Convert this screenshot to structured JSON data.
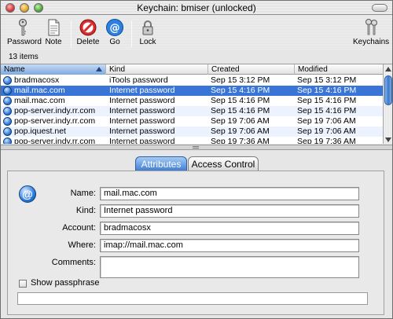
{
  "window": {
    "title": "Keychain: bmiser (unlocked)"
  },
  "toolbar": {
    "password": "Password",
    "note": "Note",
    "delete": "Delete",
    "go": "Go",
    "lock": "Lock",
    "keychains": "Keychains"
  },
  "status": {
    "count": "13 items"
  },
  "list": {
    "columns": [
      "Name",
      "Kind",
      "Created",
      "Modified"
    ],
    "rows": [
      {
        "name": "bradmacosx",
        "kind": "iTools password",
        "created": "Sep 15  3:12  PM",
        "modified": "Sep 15  3:12  PM"
      },
      {
        "name": "mail.mac.com",
        "kind": "Internet password",
        "created": "Sep 15  4:16  PM",
        "modified": "Sep 15  4:16  PM"
      },
      {
        "name": "mail.mac.com",
        "kind": "Internet password",
        "created": "Sep 15  4:16  PM",
        "modified": "Sep 15  4:16  PM"
      },
      {
        "name": "pop-server.indy.rr.com",
        "kind": "Internet password",
        "created": "Sep 15  4:16  PM",
        "modified": "Sep 15  4:16  PM"
      },
      {
        "name": "pop-server.indy.rr.com",
        "kind": "Internet password",
        "created": "Sep 19  7:06  AM",
        "modified": "Sep 19  7:06  AM"
      },
      {
        "name": "pop.iquest.net",
        "kind": "Internet password",
        "created": "Sep 19  7:06  AM",
        "modified": "Sep 19  7:06  AM"
      },
      {
        "name": "pop-server.indy.rr.com",
        "kind": "Internet password",
        "created": "Sep 19  7:36  AM",
        "modified": "Sep 19  7:36  AM"
      }
    ]
  },
  "tabs": {
    "attributes": "Attributes",
    "access": "Access Control"
  },
  "attributes": {
    "icon_symbol": "@",
    "name_label": "Name:",
    "name_value": "mail.mac.com",
    "kind_label": "Kind:",
    "kind_value": "Internet password",
    "account_label": "Account:",
    "account_value": "bradmacosx",
    "where_label": "Where:",
    "where_value": "imap://mail.mac.com",
    "comments_label": "Comments:",
    "comments_value": "",
    "show_passphrase": "Show passphrase"
  }
}
